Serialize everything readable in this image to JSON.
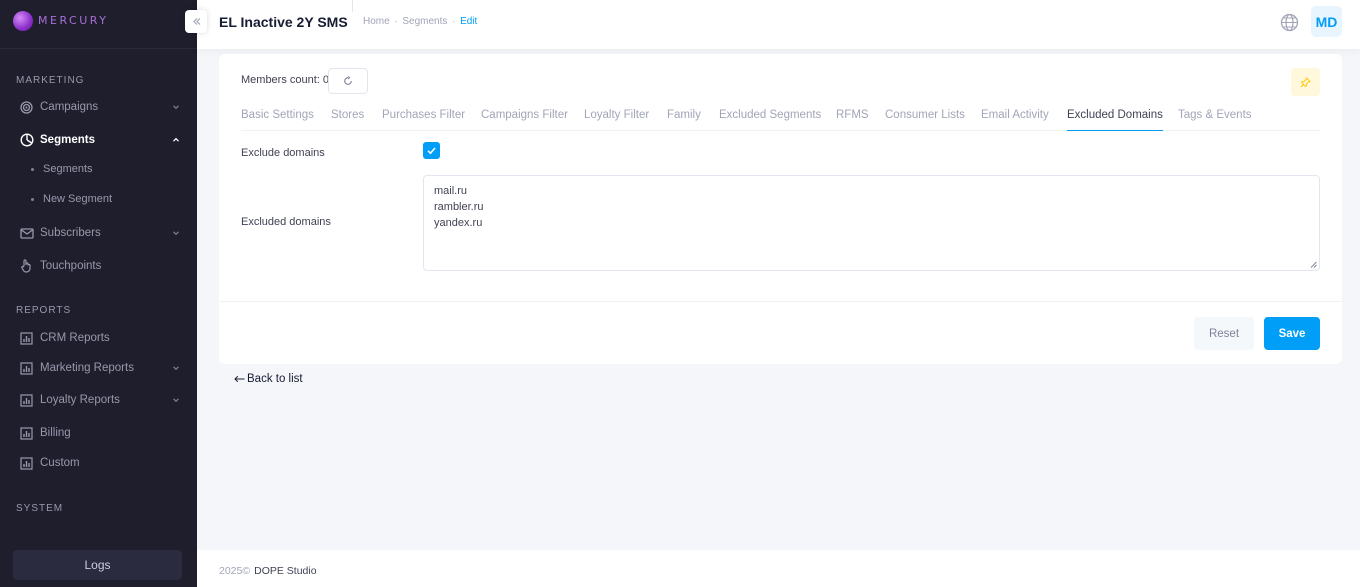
{
  "brand": {
    "name": "MERCURY"
  },
  "sidebar": {
    "sections": [
      {
        "title": "MARKETING"
      },
      {
        "title": "REPORTS"
      },
      {
        "title": "SYSTEM"
      }
    ],
    "items": [
      {
        "label": "Campaigns",
        "icon": "target-icon",
        "expandable": true
      },
      {
        "label": "Segments",
        "icon": "pie-chart-icon",
        "expandable": true,
        "active": true
      },
      {
        "label": "Subscribers",
        "icon": "mail-icon",
        "expandable": true
      },
      {
        "label": "Touchpoints",
        "icon": "hand-pointer-icon"
      },
      {
        "label": "CRM Reports",
        "icon": "bar-chart-icon"
      },
      {
        "label": "Marketing Reports",
        "icon": "bar-chart-icon",
        "expandable": true
      },
      {
        "label": "Loyalty Reports",
        "icon": "bar-chart-icon",
        "expandable": true
      },
      {
        "label": "Billing",
        "icon": "bar-chart-icon"
      },
      {
        "label": "Custom",
        "icon": "bar-chart-icon"
      }
    ],
    "sub_items": [
      {
        "label": "Segments"
      },
      {
        "label": "New Segment"
      }
    ],
    "logs_label": "Logs"
  },
  "header": {
    "title": "EL Inactive 2Y SMS",
    "breadcrumb": [
      "Home",
      "Segments",
      "Edit"
    ],
    "avatar_initials": "MD"
  },
  "card": {
    "members_count_label": "Members count: 0",
    "tabs": [
      {
        "label": "Basic Settings"
      },
      {
        "label": "Stores"
      },
      {
        "label": "Purchases Filter"
      },
      {
        "label": "Campaigns Filter"
      },
      {
        "label": "Loyalty Filter"
      },
      {
        "label": "Family"
      },
      {
        "label": "Excluded Segments"
      },
      {
        "label": "RFMS"
      },
      {
        "label": "Consumer Lists"
      },
      {
        "label": "Email Activity"
      },
      {
        "label": "Excluded Domains",
        "active": true
      },
      {
        "label": "Tags & Events"
      }
    ],
    "exclude_domains_label": "Exclude domains",
    "exclude_domains_checked": true,
    "excluded_domains_label": "Excluded domains",
    "excluded_domains": [
      "mail.ru",
      "rambler.ru",
      "yandex.ru"
    ],
    "reset_label": "Reset",
    "save_label": "Save"
  },
  "back_link": "Back to list",
  "footer": {
    "year": "2025©",
    "company": "DOPE Studio"
  },
  "colors": {
    "primary": "#009ef7",
    "sidebar_bg": "#1e1e2d",
    "pin_bg": "#fff8dd"
  }
}
